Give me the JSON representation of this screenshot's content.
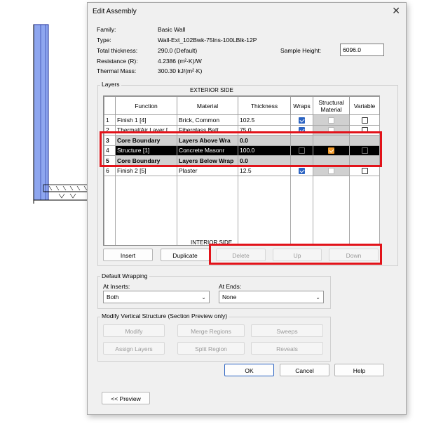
{
  "dialog": {
    "title": "Edit Assembly",
    "close_glyph": "✕"
  },
  "info": {
    "family_label": "Family:",
    "family_value": "Basic Wall",
    "type_label": "Type:",
    "type_value": "Wall-Ext_102Bwk-75Ins-100LBlk-12P",
    "thickness_label": "Total thickness:",
    "thickness_value": "290.0 (Default)",
    "resistance_label": "Resistance (R):",
    "resistance_value": "4.2386 (m²·K)/W",
    "mass_label": "Thermal Mass:",
    "mass_value": "300.30 kJ/(m²·K)",
    "sample_height_label": "Sample Height:",
    "sample_height_value": "6096.0"
  },
  "layers": {
    "group_label": "Layers",
    "exterior_label": "EXTERIOR SIDE",
    "interior_label": "INTERIOR SIDE",
    "columns": [
      "Function",
      "Material",
      "Thickness",
      "Wraps",
      "Structural Material",
      "Variable"
    ],
    "rows": [
      {
        "num": "1",
        "function": "Finish 1 [4]",
        "material": "Brick, Common",
        "thickness": "102.5"
      },
      {
        "num": "2",
        "function": "Thermal/Air Layer [",
        "material": "Fiberglass Batt",
        "thickness": "75.0"
      },
      {
        "num": "3",
        "function": "Core Boundary",
        "material": "Layers Above Wra",
        "thickness": "0.0"
      },
      {
        "num": "4",
        "function": "Structure [1]",
        "material": "Concrete Masonr",
        "thickness": "100.0"
      },
      {
        "num": "5",
        "function": "Core Boundary",
        "material": "Layers Below Wrap",
        "thickness": "0.0"
      },
      {
        "num": "6",
        "function": "Finish 2 [5]",
        "material": "Plaster",
        "thickness": "12.5"
      }
    ]
  },
  "buttons": {
    "insert": "Insert",
    "duplicate": "Duplicate",
    "delete": "Delete",
    "up": "Up",
    "down": "Down",
    "modify": "Modify",
    "merge_regions": "Merge Regions",
    "sweeps": "Sweeps",
    "assign_layers": "Assign Layers",
    "split_region": "Split Region",
    "reveals": "Reveals",
    "ok": "OK",
    "cancel": "Cancel",
    "help": "Help",
    "preview": "<< Preview"
  },
  "wrapping": {
    "group_label": "Default Wrapping",
    "at_inserts_label": "At Inserts:",
    "at_inserts_value": "Both",
    "at_ends_label": "At Ends:",
    "at_ends_value": "None"
  },
  "vertical": {
    "group_label": "Modify Vertical Structure (Section Preview only)"
  },
  "colors": {
    "highlight_red": "#e2131a",
    "check_blue": "#2b63c2",
    "check_orange": "#f39b2a",
    "wall_blue": "#3b5fd6"
  }
}
